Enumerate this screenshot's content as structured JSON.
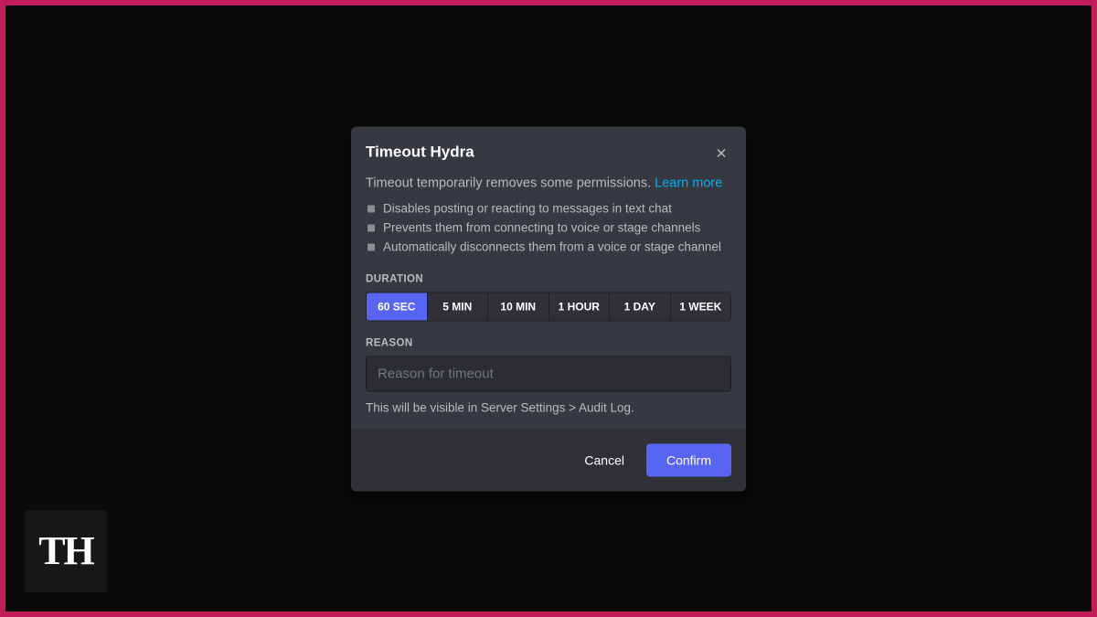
{
  "watermark": {
    "label": "TH"
  },
  "modal": {
    "title": "Timeout Hydra",
    "description_text": "Timeout temporarily removes some permissions. ",
    "learn_more": "Learn more",
    "bullets": [
      "Disables posting or reacting to messages in text chat",
      "Prevents them from connecting to voice or stage channels",
      "Automatically disconnects them from a voice or stage channel"
    ],
    "duration": {
      "label": "DURATION",
      "options": [
        "60 SEC",
        "5 MIN",
        "10 MIN",
        "1 HOUR",
        "1 DAY",
        "1 WEEK"
      ],
      "selected_index": 0
    },
    "reason": {
      "label": "REASON",
      "placeholder": "Reason for timeout",
      "value": ""
    },
    "audit_note": "This will be visible in Server Settings > Audit Log.",
    "footer": {
      "cancel": "Cancel",
      "confirm": "Confirm"
    }
  },
  "colors": {
    "accent": "#5865f2",
    "link": "#00aff4",
    "frame": "#c41e5a"
  }
}
